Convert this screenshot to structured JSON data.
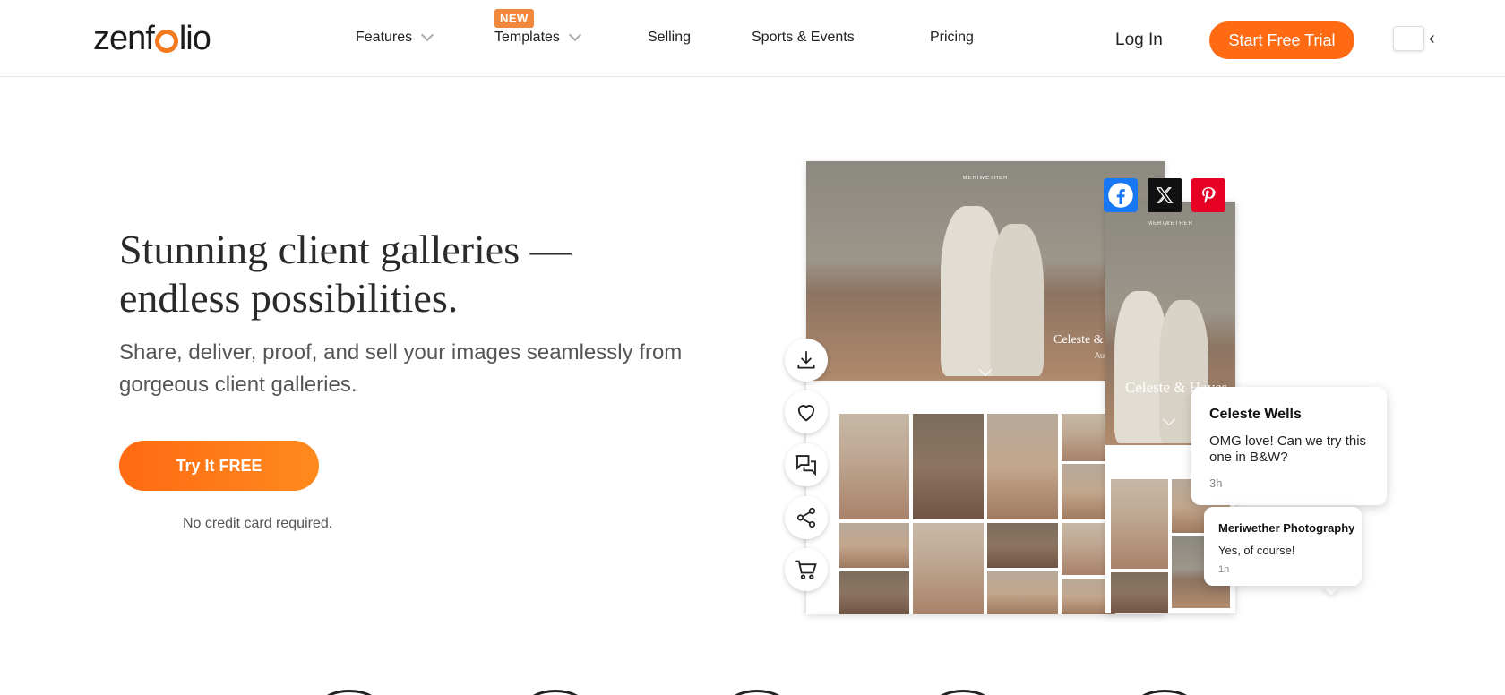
{
  "header": {
    "logo": "zenfolio",
    "nav": [
      {
        "label": "Features",
        "dropdown": true
      },
      {
        "label": "Templates",
        "dropdown": true,
        "badge": "NEW"
      },
      {
        "label": "Selling",
        "dropdown": false
      },
      {
        "label": "Sports & Events",
        "dropdown": false
      },
      {
        "label": "Pricing",
        "dropdown": false
      }
    ],
    "login_label": "Log In",
    "cta_label": "Start Free Trial",
    "lang_caret": "‹"
  },
  "hero": {
    "title": "Stunning client galleries — endless possibilities.",
    "subtitle": "Share, deliver, proof, and sell your images seamlessly from gorgeous client galleries.",
    "button_label": "Try It FREE",
    "note": "No credit card required."
  },
  "gallery_mock": {
    "brand_small": "MERIWETHER",
    "couple_name": "Celeste & U",
    "couple_name_side": "Celeste & Hayes",
    "date_short": "Aug",
    "comments": [
      {
        "name": "Celeste Wells",
        "message": "OMG love! Can we try this one in B&W?",
        "time": "3h"
      },
      {
        "name": "Meriwether Photography",
        "message": "Yes, of course!",
        "time": "1h"
      }
    ],
    "social_icons": [
      "facebook-icon",
      "x-icon",
      "pinterest-icon"
    ],
    "tools": [
      "download-icon",
      "heart-icon",
      "comments-icon",
      "share-icon",
      "cart-icon"
    ]
  },
  "colors": {
    "accent": "#ff6a12",
    "facebook": "#1877f2",
    "pinterest": "#e60023"
  }
}
